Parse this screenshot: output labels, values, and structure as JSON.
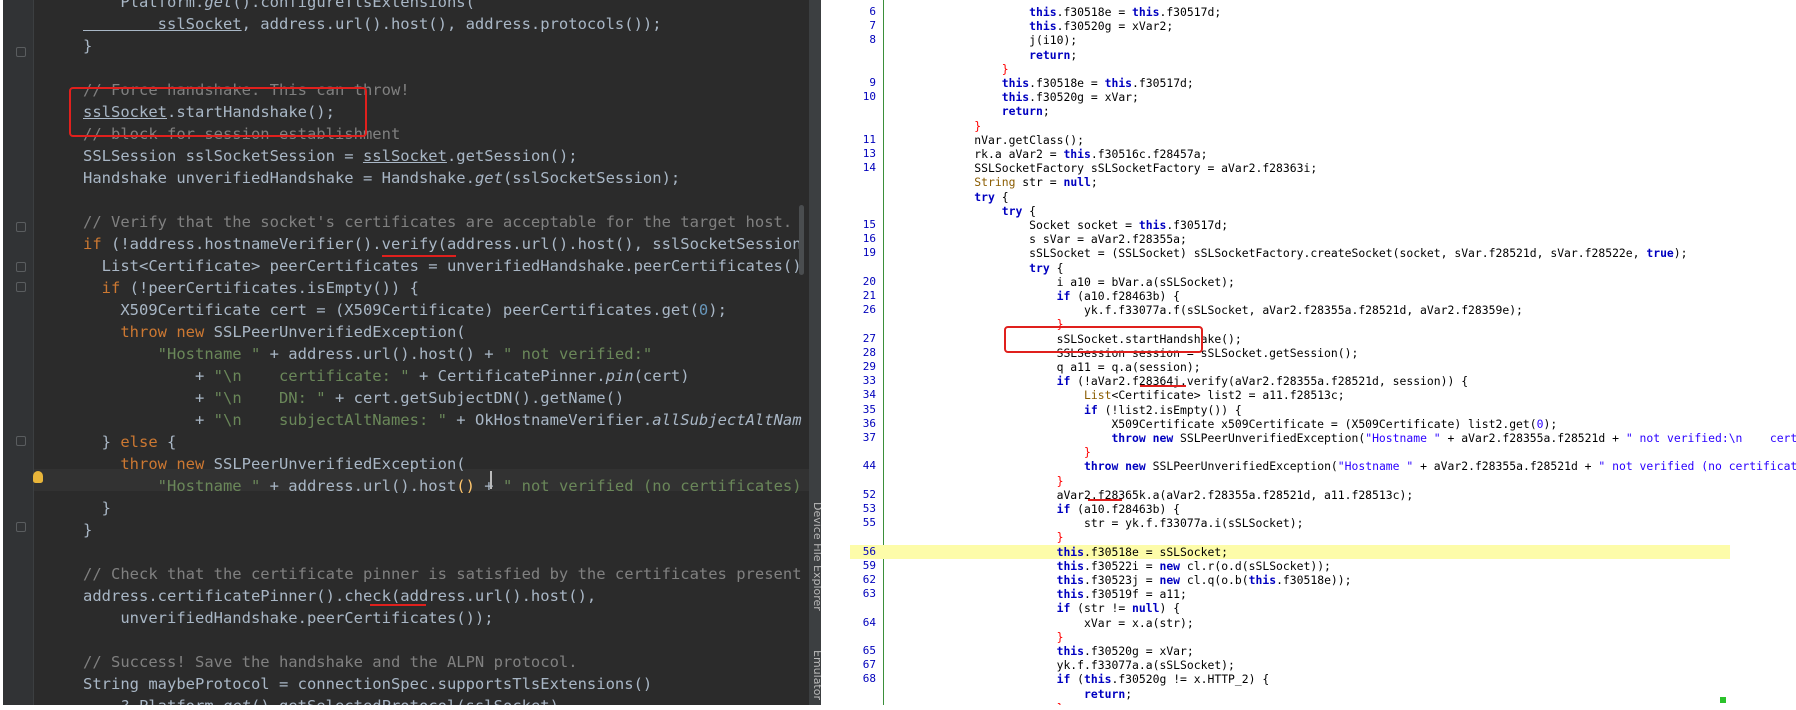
{
  "left_editor": {
    "side_tabs": [
      "Device File Explorer",
      "Emulator"
    ],
    "lines": [
      [
        [
          "d",
          "    Platform."
        ],
        [
          "it",
          "get"
        ],
        [
          "d",
          "().configureTlsExtensions("
        ]
      ],
      [
        [
          "ud",
          "        sslSocket"
        ],
        [
          "d",
          ", address.url().host(), address.protocols());"
        ]
      ],
      [
        [
          "d",
          "}"
        ]
      ],
      [
        [
          "d",
          ""
        ]
      ],
      [
        [
          "cm",
          "// Force handshake. This can throw!"
        ]
      ],
      [
        [
          "ud",
          "sslSocket"
        ],
        [
          "d",
          ".startHandshake();"
        ]
      ],
      [
        [
          "cm",
          "// block for session establishment"
        ]
      ],
      [
        [
          "d",
          "SSLSession sslSocketSession = "
        ],
        [
          "ud",
          "sslSocket"
        ],
        [
          "d",
          ".getSession();"
        ]
      ],
      [
        [
          "d",
          "Handshake unverifiedHandshake = Handshake."
        ],
        [
          "it",
          "get"
        ],
        [
          "d",
          "(sslSocketSession);"
        ]
      ],
      [
        [
          "d",
          ""
        ]
      ],
      [
        [
          "cm",
          "// Verify that the socket's certificates are acceptable for the target host."
        ]
      ],
      [
        [
          "kw",
          "if "
        ],
        [
          "d",
          "(!address.hostnameVerifier().verify(address.url().host(), sslSocketSession"
        ]
      ],
      [
        [
          "d",
          "  List<Certificate> peerCertificates = unverifiedHandshake.peerCertificates()"
        ]
      ],
      [
        [
          "kw",
          "  if "
        ],
        [
          "d",
          "(!peerCertificates.isEmpty()) {"
        ]
      ],
      [
        [
          "d",
          "    X509Certificate cert = (X509Certificate) peerCertificates.get("
        ],
        [
          "nm",
          "0"
        ],
        [
          "d",
          ");"
        ]
      ],
      [
        [
          "kw",
          "    throw new "
        ],
        [
          "d",
          "SSLPeerUnverifiedException("
        ]
      ],
      [
        [
          "st",
          "        \"Hostname \""
        ],
        [
          "d",
          " + address.url().host() + "
        ],
        [
          "st",
          "\" not verified:\""
        ]
      ],
      [
        [
          "d",
          "            + "
        ],
        [
          "st",
          "\"\\n    certificate: \""
        ],
        [
          "d",
          " + CertificatePinner."
        ],
        [
          "it",
          "pin"
        ],
        [
          "d",
          "(cert)"
        ]
      ],
      [
        [
          "d",
          "            + "
        ],
        [
          "st",
          "\"\\n    DN: \""
        ],
        [
          "d",
          " + cert.getSubjectDN().getName()"
        ]
      ],
      [
        [
          "d",
          "            + "
        ],
        [
          "st",
          "\"\\n    subjectAltNames: \""
        ],
        [
          "d",
          " + OkHostnameVerifier."
        ],
        [
          "it",
          "allSubjectAltNam"
        ]
      ],
      [
        [
          "d",
          "  } "
        ],
        [
          "kw",
          "else "
        ],
        [
          "d",
          "{"
        ]
      ],
      [
        [
          "kw",
          "    throw new "
        ],
        [
          "d",
          "SSLPeerUnverifiedException("
        ]
      ],
      [
        [
          "st",
          "        \"Hostname \""
        ],
        [
          "d",
          " + address.url().host"
        ],
        [
          "fn",
          "()"
        ],
        [
          "d",
          " + "
        ],
        [
          "st",
          "\" not verified (no certificates)"
        ]
      ],
      [
        [
          "d",
          "  }"
        ]
      ],
      [
        [
          "d",
          "}"
        ]
      ],
      [
        [
          "d",
          ""
        ]
      ],
      [
        [
          "cm",
          "// Check that the certificate pinner is satisfied by the certificates present"
        ]
      ],
      [
        [
          "d",
          "address.certificatePinner().check(address.url().host(),"
        ]
      ],
      [
        [
          "d",
          "    unverifiedHandshake.peerCertificates());"
        ]
      ],
      [
        [
          "d",
          ""
        ]
      ],
      [
        [
          "cm",
          "// Success! Save the handshake and the ALPN protocol."
        ]
      ],
      [
        [
          "d",
          "String maybeProtocol = connectionSpec.supportsTlsExtensions()"
        ]
      ],
      [
        [
          "d",
          "    ? Platform."
        ],
        [
          "it",
          "get"
        ],
        [
          "d",
          "().getSelectedProtocol(sslSocket)"
        ]
      ]
    ]
  },
  "right_panel": {
    "lines": [
      {
        "n": "6",
        "c": [
          [
            "d",
            "                    "
          ],
          [
            "k",
            "this"
          ],
          [
            "d",
            ".f30518e = "
          ],
          [
            "k",
            "this"
          ],
          [
            "d",
            ".f30517d;"
          ]
        ]
      },
      {
        "n": "7",
        "c": [
          [
            "d",
            "                    "
          ],
          [
            "k",
            "this"
          ],
          [
            "d",
            ".f30520g = xVar2;"
          ]
        ]
      },
      {
        "n": "8",
        "c": [
          [
            "d",
            "                    j(i10);"
          ]
        ]
      },
      {
        "n": "",
        "c": [
          [
            "d",
            "                    "
          ],
          [
            "k",
            "return"
          ],
          [
            "d",
            ";"
          ]
        ]
      },
      {
        "n": "",
        "c": [
          [
            "r",
            "                }"
          ]
        ]
      },
      {
        "n": "9",
        "c": [
          [
            "d",
            "                "
          ],
          [
            "k",
            "this"
          ],
          [
            "d",
            ".f30518e = "
          ],
          [
            "k",
            "this"
          ],
          [
            "d",
            ".f30517d;"
          ]
        ]
      },
      {
        "n": "10",
        "c": [
          [
            "d",
            "                "
          ],
          [
            "k",
            "this"
          ],
          [
            "d",
            ".f30520g = xVar;"
          ]
        ]
      },
      {
        "n": "",
        "c": [
          [
            "d",
            "                "
          ],
          [
            "k",
            "return"
          ],
          [
            "d",
            ";"
          ]
        ]
      },
      {
        "n": "",
        "c": [
          [
            "r",
            "            }"
          ]
        ]
      },
      {
        "n": "11",
        "c": [
          [
            "d",
            "            nVar.getClass();"
          ]
        ]
      },
      {
        "n": "13",
        "c": [
          [
            "d",
            "            rk.a aVar2 = "
          ],
          [
            "k",
            "this"
          ],
          [
            "d",
            ".f30516c.f28457a;"
          ]
        ]
      },
      {
        "n": "14",
        "c": [
          [
            "d",
            "            SSLSocketFactory sSLSocketFactory = aVar2.f28363i;"
          ]
        ]
      },
      {
        "n": "",
        "c": [
          [
            "d",
            "            "
          ],
          [
            "t",
            "String"
          ],
          [
            "d",
            " str = "
          ],
          [
            "k",
            "null"
          ],
          [
            "d",
            ";"
          ]
        ]
      },
      {
        "n": "",
        "c": [
          [
            "d",
            "            "
          ],
          [
            "k",
            "try"
          ],
          [
            "d",
            " {"
          ]
        ]
      },
      {
        "n": "",
        "c": [
          [
            "d",
            "                "
          ],
          [
            "k",
            "try"
          ],
          [
            "d",
            " {"
          ]
        ]
      },
      {
        "n": "15",
        "c": [
          [
            "d",
            "                    Socket socket = "
          ],
          [
            "k",
            "this"
          ],
          [
            "d",
            ".f30517d;"
          ]
        ]
      },
      {
        "n": "16",
        "c": [
          [
            "d",
            "                    s sVar = aVar2.f28355a;"
          ]
        ]
      },
      {
        "n": "19",
        "c": [
          [
            "d",
            "                    sSLSocket = (SSLSocket) sSLSocketFactory.createSocket(socket, sVar.f28521d, sVar.f28522e, "
          ],
          [
            "k",
            "true"
          ],
          [
            "d",
            ");"
          ]
        ]
      },
      {
        "n": "",
        "c": [
          [
            "d",
            "                    "
          ],
          [
            "k",
            "try"
          ],
          [
            "d",
            " {"
          ]
        ]
      },
      {
        "n": "20",
        "c": [
          [
            "d",
            "                        i a10 = bVar.a(sSLSocket);"
          ]
        ]
      },
      {
        "n": "21",
        "c": [
          [
            "d",
            "                        "
          ],
          [
            "k",
            "if"
          ],
          [
            "d",
            " (a10.f28463b) {"
          ]
        ]
      },
      {
        "n": "26",
        "c": [
          [
            "d",
            "                            yk.f.f33077a.f(sSLSocket, aVar2.f28355a.f28521d, aVar2.f28359e);"
          ]
        ]
      },
      {
        "n": "",
        "c": [
          [
            "r",
            "                        }"
          ]
        ]
      },
      {
        "n": "27",
        "c": [
          [
            "d",
            "                        sSLSocket.startHandshake();"
          ]
        ]
      },
      {
        "n": "28",
        "c": [
          [
            "d",
            "                        SSLSession session = sSLSocket.getSession();"
          ]
        ]
      },
      {
        "n": "29",
        "c": [
          [
            "d",
            "                        q a11 = q.a(session);"
          ]
        ]
      },
      {
        "n": "33",
        "c": [
          [
            "d",
            "                        "
          ],
          [
            "k",
            "if"
          ],
          [
            "d",
            " (!aVar2.f28364j.verify(aVar2.f28355a.f28521d, session)) {"
          ]
        ]
      },
      {
        "n": "34",
        "c": [
          [
            "d",
            "                            "
          ],
          [
            "t",
            "List"
          ],
          [
            "d",
            "<Certificate> list2 = a11.f28513c;"
          ]
        ]
      },
      {
        "n": "35",
        "c": [
          [
            "d",
            "                            "
          ],
          [
            "k",
            "if"
          ],
          [
            "d",
            " (!list2.isEmpty()) {"
          ]
        ]
      },
      {
        "n": "36",
        "c": [
          [
            "d",
            "                                X509Certificate x509Certificate = (X509Certificate) list2.get("
          ],
          [
            "s",
            "0"
          ],
          [
            "d",
            ");"
          ]
        ]
      },
      {
        "n": "37",
        "c": [
          [
            "d",
            "                                "
          ],
          [
            "k",
            "throw new"
          ],
          [
            "d",
            " SSLPeerUnverifiedException("
          ],
          [
            "s",
            "\"Hostname \""
          ],
          [
            "d",
            " + aVar2.f28355a.f28521d + "
          ],
          [
            "s",
            "\" not verified:\\n    certi"
          ]
        ]
      },
      {
        "n": "",
        "c": [
          [
            "r",
            "                            }"
          ]
        ]
      },
      {
        "n": "44",
        "c": [
          [
            "d",
            "                            "
          ],
          [
            "k",
            "throw new"
          ],
          [
            "d",
            " SSLPeerUnverifiedException("
          ],
          [
            "s",
            "\"Hostname \""
          ],
          [
            "d",
            " + aVar2.f28355a.f28521d + "
          ],
          [
            "s",
            "\" not verified (no certificate"
          ]
        ]
      },
      {
        "n": "",
        "c": [
          [
            "r",
            "                        }"
          ]
        ]
      },
      {
        "n": "52",
        "c": [
          [
            "d",
            "                        aVar2.f28365k.a(aVar2.f28355a.f28521d, a11.f28513c);"
          ]
        ]
      },
      {
        "n": "53",
        "c": [
          [
            "d",
            "                        "
          ],
          [
            "k",
            "if"
          ],
          [
            "d",
            " (a10.f28463b) {"
          ]
        ]
      },
      {
        "n": "55",
        "c": [
          [
            "d",
            "                            str = yk.f.f33077a.i(sSLSocket);"
          ]
        ]
      },
      {
        "n": "",
        "c": [
          [
            "r",
            "                        }"
          ]
        ]
      },
      {
        "n": "56",
        "hl": true,
        "c": [
          [
            "d",
            "                        "
          ],
          [
            "k",
            "this"
          ],
          [
            "d",
            ".f30518e = sSLSocket;"
          ]
        ]
      },
      {
        "n": "59",
        "c": [
          [
            "d",
            "                        "
          ],
          [
            "k",
            "this"
          ],
          [
            "d",
            ".f30522i = "
          ],
          [
            "k",
            "new"
          ],
          [
            "d",
            " cl.r(o.d(sSLSocket));"
          ]
        ]
      },
      {
        "n": "62",
        "c": [
          [
            "d",
            "                        "
          ],
          [
            "k",
            "this"
          ],
          [
            "d",
            ".f30523j = "
          ],
          [
            "k",
            "new"
          ],
          [
            "d",
            " cl.q(o.b("
          ],
          [
            "k",
            "this"
          ],
          [
            "d",
            ".f30518e));"
          ]
        ]
      },
      {
        "n": "63",
        "c": [
          [
            "d",
            "                        "
          ],
          [
            "k",
            "this"
          ],
          [
            "d",
            ".f30519f = a11;"
          ]
        ]
      },
      {
        "n": "",
        "c": [
          [
            "d",
            "                        "
          ],
          [
            "k",
            "if"
          ],
          [
            "d",
            " (str != "
          ],
          [
            "k",
            "null"
          ],
          [
            "d",
            ") {"
          ]
        ]
      },
      {
        "n": "64",
        "c": [
          [
            "d",
            "                            xVar = x.a(str);"
          ]
        ]
      },
      {
        "n": "",
        "c": [
          [
            "r",
            "                        }"
          ]
        ]
      },
      {
        "n": "65",
        "c": [
          [
            "d",
            "                        "
          ],
          [
            "k",
            "this"
          ],
          [
            "d",
            ".f30520g = xVar;"
          ]
        ]
      },
      {
        "n": "67",
        "c": [
          [
            "d",
            "                        yk.f.f33077a.a(sSLSocket);"
          ]
        ]
      },
      {
        "n": "68",
        "c": [
          [
            "d",
            "                        "
          ],
          [
            "k",
            "if"
          ],
          [
            "d",
            " ("
          ],
          [
            "k",
            "this"
          ],
          [
            "d",
            ".f30520g != x.HTTP_2) {"
          ]
        ]
      },
      {
        "n": "",
        "c": [
          [
            "d",
            "                            "
          ],
          [
            "k",
            "return"
          ],
          [
            "d",
            ";"
          ]
        ]
      },
      {
        "n": "",
        "c": [
          [
            "r",
            "                        }"
          ]
        ]
      }
    ]
  }
}
